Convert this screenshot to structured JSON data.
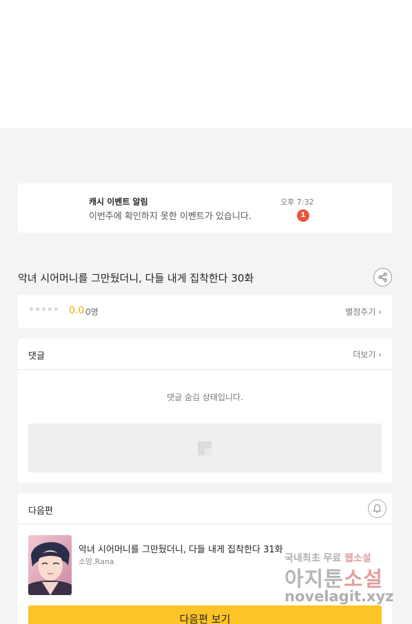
{
  "notification": {
    "title": "캐시 이벤트 알림",
    "body": "이번주에 확인하지 못한 이벤트가 있습니다.",
    "time": "오후 7:32",
    "badge": "1",
    "badge_color": "#e8583a"
  },
  "episode": {
    "title": "악녀 시어머니를 그만뒀더니, 다들 내게 집착한다 30화",
    "share_icon": "share-icon"
  },
  "rating": {
    "stars": "★★★★★",
    "stars_filled": 0,
    "score": "0.0",
    "count": "0명",
    "rate_link": "별점주기 ›",
    "score_color": "#f5a400"
  },
  "comments": {
    "label": "댓글",
    "more_link": "더보기 ›",
    "hidden_message": "댓글 숨김 상태입니다."
  },
  "next_episode": {
    "label": "다음편",
    "title": "악녀 시어머니를 그만뒀더니, 다들 내게 집착한다 31화",
    "author": "소망,Rana",
    "button": "다음편 보기",
    "button_color": "#fdc427",
    "bell_icon": "bell-icon"
  },
  "watermark": {
    "line1_a": "국내최초 무료 ",
    "line1_b": "웹소설",
    "line2_a": "아지툰",
    "line2_b": "소설",
    "line3": "novelagit.xyz"
  }
}
